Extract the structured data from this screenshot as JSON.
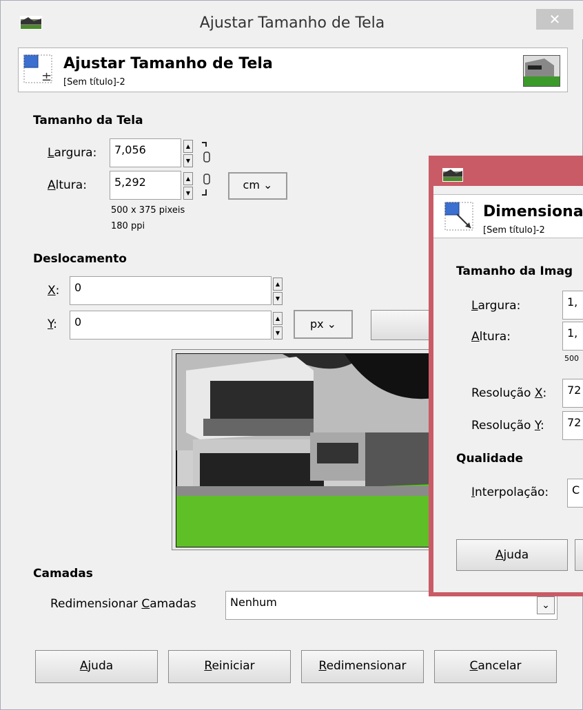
{
  "main_window": {
    "title": "Ajustar Tamanho de Tela",
    "header_title": "Ajustar Tamanho de Tela",
    "header_subtitle": "[Sem título]-2",
    "canvas_size": {
      "section": "Tamanho da Tela",
      "width_label_u": "L",
      "width_label_rest": "argura:",
      "width_value": "7,056",
      "height_label_u": "A",
      "height_label_rest": "ltura:",
      "height_value": "5,292",
      "unit": "cm",
      "pixels_info": "500 x 375 pixeis",
      "ppi_info": "180 ppi"
    },
    "offset": {
      "section": "Deslocamento",
      "x_label_u": "X",
      "x_label_rest": ":",
      "x_value": "0",
      "y_label_u": "Y",
      "y_label_rest": ":",
      "y_value": "0",
      "unit": "px"
    },
    "layers": {
      "section": "Camadas",
      "resize_label_pre": "Redimensionar ",
      "resize_label_u": "C",
      "resize_label_rest": "amadas",
      "resize_value": "Nenhum"
    },
    "buttons": {
      "help_u": "A",
      "help_rest": "juda",
      "reset_u": "R",
      "reset_rest": "einiciar",
      "resize_u": "R",
      "resize_rest": "edimensionar",
      "cancel_u": "C",
      "cancel_rest": "ancelar"
    }
  },
  "scale_window": {
    "header_title": "Dimensiona",
    "header_subtitle": "[Sem título]-2",
    "section_size": "Tamanho da Imag",
    "width_label_u": "L",
    "width_label_rest": "argura:",
    "width_value": "1,",
    "height_label_u": "A",
    "height_label_rest": "ltura:",
    "height_value": "1,",
    "pixels_info": "500",
    "res_x_label_pre": "Resolução ",
    "res_x_label_u": "X",
    "res_x_label_rest": ":",
    "res_x_value": "72",
    "res_y_label_pre": "Resolução ",
    "res_y_label_u": "Y",
    "res_y_label_rest": ":",
    "res_y_value": "72",
    "section_quality": "Qualidade",
    "interp_label_u": "I",
    "interp_label_rest": "nterpolação:",
    "interp_value": "C",
    "help_u": "A",
    "help_rest": "juda"
  },
  "icons": [
    "gimp-window-icon",
    "canvas-size-icon",
    "image-thumbnail-icon",
    "chain-link-icon",
    "scale-image-icon"
  ],
  "colors": {
    "scale_window_border": "#c95b66",
    "window_bg": "#f0f0f0"
  }
}
